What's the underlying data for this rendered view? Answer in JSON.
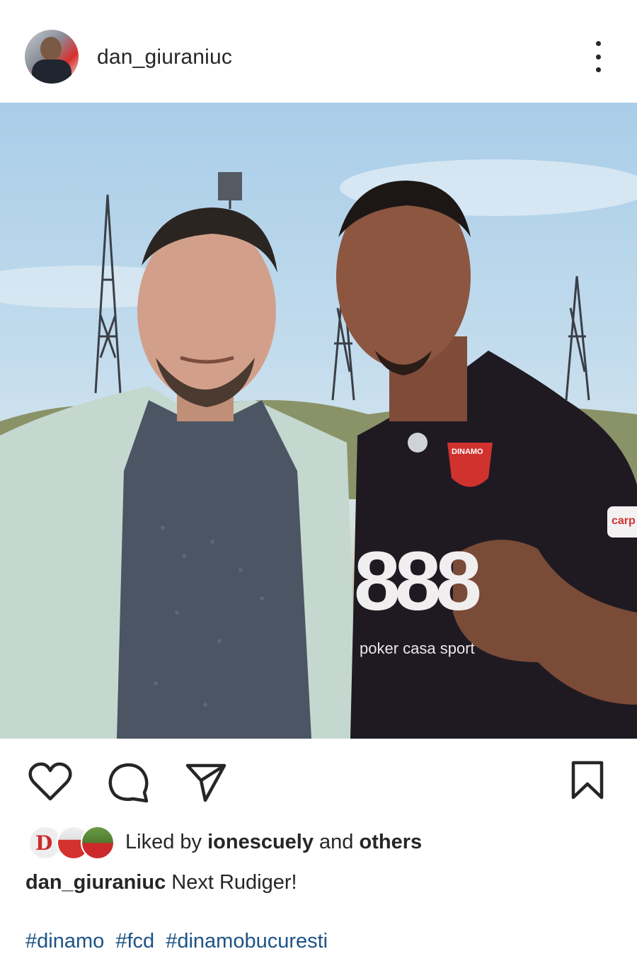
{
  "post": {
    "username": "dan_giuraniuc",
    "more_icon": "more-vertical-icon",
    "image_jersey_number": "888",
    "image_sponsor_text": "poker casa sport",
    "image_crest_text": "DINAMO",
    "image_sleeve_text": "carp"
  },
  "actions": {
    "like_icon": "heart-icon",
    "comment_icon": "comment-icon",
    "share_icon": "send-icon",
    "save_icon": "bookmark-icon"
  },
  "likes": {
    "prefix": "Liked by",
    "user": "ionescuely",
    "middle": "and",
    "others": "others"
  },
  "caption": {
    "username": "dan_giuraniuc",
    "text": "Next Rudiger!"
  },
  "hashtags": [
    "#dinamo",
    "#fcd",
    "#dinamobucuresti"
  ],
  "colors": {
    "text": "#262626",
    "hashtag": "#1c5386",
    "background": "#ffffff"
  }
}
